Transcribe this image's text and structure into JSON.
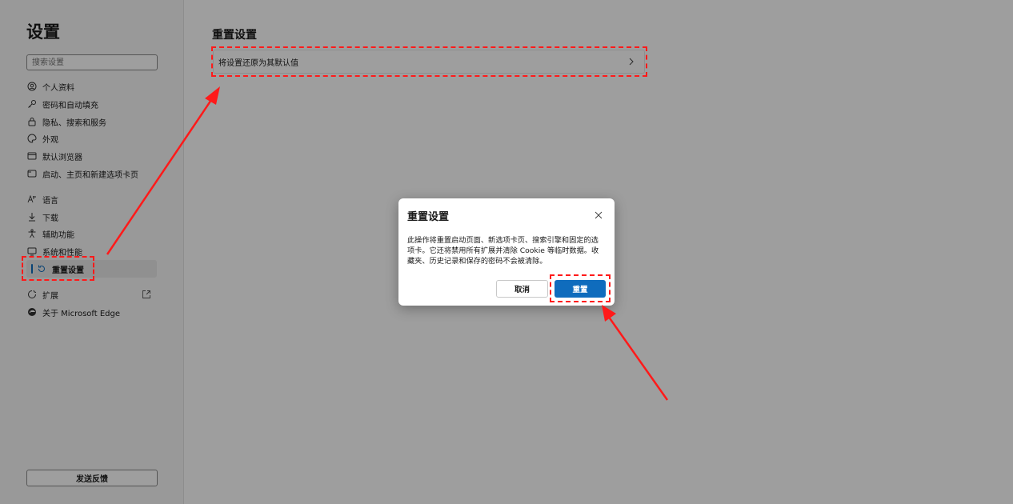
{
  "sidebar": {
    "title": "设置",
    "search_placeholder": "搜索设置",
    "items": [
      {
        "label": "个人资料",
        "icon": "profile-icon"
      },
      {
        "label": "密码和自动填充",
        "icon": "key-icon"
      },
      {
        "label": "隐私、搜索和服务",
        "icon": "lock-icon"
      },
      {
        "label": "外观",
        "icon": "palette-icon"
      },
      {
        "label": "默认浏览器",
        "icon": "browser-icon"
      },
      {
        "label": "启动、主页和新建选项卡页",
        "icon": "window-icon"
      },
      {
        "label": "语言",
        "icon": "language-icon"
      },
      {
        "label": "下载",
        "icon": "download-icon"
      },
      {
        "label": "辅助功能",
        "icon": "accessibility-icon"
      },
      {
        "label": "系统和性能",
        "icon": "monitor-icon"
      },
      {
        "label": "重置设置",
        "icon": "reset-icon"
      },
      {
        "label": "扩展",
        "icon": "puzzle-icon"
      },
      {
        "label": "关于 Microsoft Edge",
        "icon": "edge-logo-icon"
      }
    ],
    "feedback_label": "发送反馈"
  },
  "main": {
    "title": "重置设置",
    "reset_row_label": "将设置还原为其默认值"
  },
  "dialog": {
    "title": "重置设置",
    "body_line1": "此操作将重置启动页面、新选项卡页、搜索引擎和固定的选",
    "body_line2": "项卡。它还将禁用所有扩展并清除 Cookie 等临时数据。收",
    "body_line3": "藏夹、历史记录和保存的密码不会被清除。",
    "cancel_label": "取消",
    "reset_label": "重置"
  },
  "colors": {
    "accent": "#0f6cbd",
    "annotation": "#ff1a1a"
  }
}
